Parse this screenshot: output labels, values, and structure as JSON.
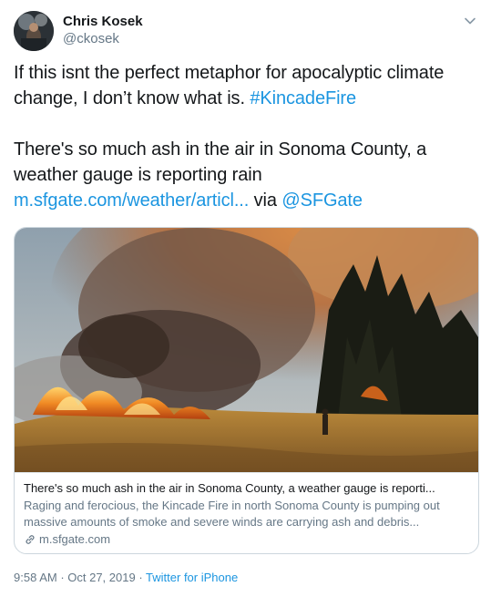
{
  "author": {
    "display_name": "Chris Kosek",
    "handle": "@ckosek"
  },
  "tweet": {
    "line1_text": "If this isnt the perfect metaphor for apocalyptic climate change, I don’t know what is. ",
    "hashtag": "#KincadeFire",
    "line2_text": "There's so much ash in the air in Sonoma County, a weather gauge is reporting rain ",
    "link": "m.sfgate.com/weather/articl...",
    "via": " via ",
    "mention": "@SFGate"
  },
  "card": {
    "title": "There's so much ash in the air in Sonoma County, a weather gauge is reporti...",
    "description": "Raging and ferocious, the Kincade Fire in north Sonoma County is pumping out massive amounts of smoke and severe winds are carrying ash and debris...",
    "domain": "m.sfgate.com"
  },
  "meta": {
    "time": "9:58 AM",
    "sep": " · ",
    "date": "Oct 27, 2019",
    "source": "Twitter for iPhone"
  },
  "colors": {
    "link": "#1b95e0",
    "secondary_text": "#657786",
    "primary_text": "#14171a",
    "border": "#ccd6dd"
  },
  "icons": [
    "avatar-photo",
    "chevron-down-icon",
    "link-icon"
  ]
}
